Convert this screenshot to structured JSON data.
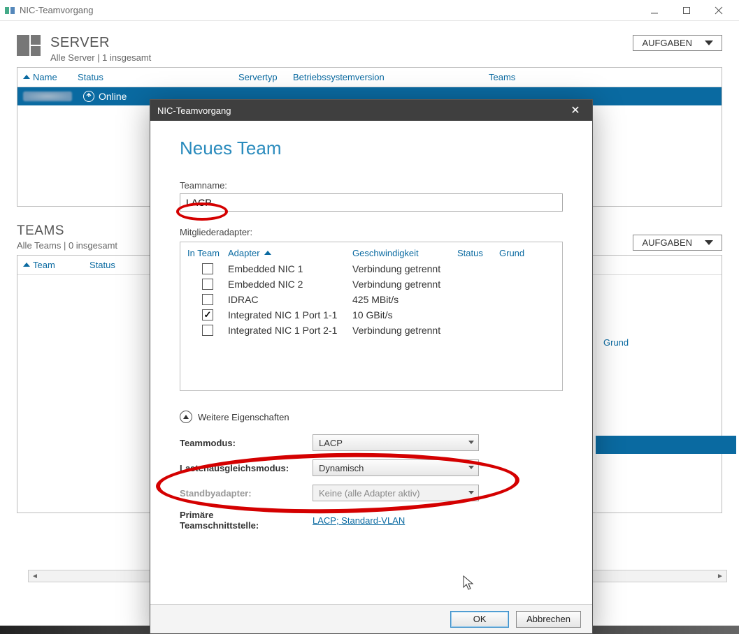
{
  "app": {
    "title": "NIC-Teamvorgang"
  },
  "servers_section": {
    "title": "SERVER",
    "subtitle": "Alle Server | 1 insgesamt",
    "tasks_label": "AUFGABEN",
    "columns": {
      "name": "Name",
      "status": "Status",
      "type": "Servertyp",
      "os": "Betriebssystemversion",
      "teams": "Teams"
    },
    "row_status": "Online"
  },
  "teams_section": {
    "title": "TEAMS",
    "subtitle": "Alle Teams | 0 insgesamt",
    "tasks_label": "AUFGABEN",
    "columns": {
      "team": "Team",
      "status": "Status"
    },
    "adapters_reason_label": "Grund"
  },
  "dialog": {
    "title": "NIC-Teamvorgang",
    "heading": "Neues Team",
    "teamname_label": "Teamname:",
    "teamname_value": "LACP",
    "members_label": "Mitgliederadapter:",
    "member_cols": {
      "inteam": "In Team",
      "adapter": "Adapter",
      "speed": "Geschwindigkeit",
      "status": "Status",
      "reason": "Grund"
    },
    "members": [
      {
        "checked": false,
        "adapter": "Embedded NIC 1",
        "speed": "Verbindung getrennt"
      },
      {
        "checked": false,
        "adapter": "Embedded NIC 2",
        "speed": "Verbindung getrennt"
      },
      {
        "checked": false,
        "adapter": "IDRAC",
        "speed": "425 MBit/s"
      },
      {
        "checked": true,
        "adapter": "Integrated NIC 1 Port 1-1",
        "speed": "10 GBit/s"
      },
      {
        "checked": false,
        "adapter": "Integrated NIC 1 Port 2-1",
        "speed": "Verbindung getrennt"
      }
    ],
    "expander_label": "Weitere Eigenschaften",
    "props": {
      "teammode_label": "Teammodus:",
      "teammode_value": "LACP",
      "lb_label": "Lastenausgleichsmodus:",
      "lb_value": "Dynamisch",
      "standby_label": "Standbyadapter:",
      "standby_value": "Keine (alle Adapter aktiv)",
      "primary_if_label1": "Primäre",
      "primary_if_label2": "Teamschnittstelle:",
      "primary_if_value": "LACP; Standard-VLAN"
    },
    "ok": "OK",
    "cancel": "Abbrechen"
  }
}
